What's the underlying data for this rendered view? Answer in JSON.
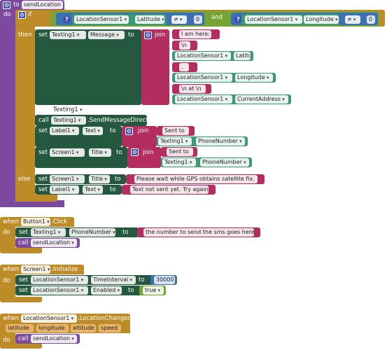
{
  "kw": {
    "to": "to",
    "do": "do",
    "if": "if",
    "then": "then",
    "else": "else",
    "set": "set",
    "call": "call",
    "join": "join",
    "when": "when",
    "and": "and",
    "eq": "≠",
    "num_zero": "0"
  },
  "proc": {
    "name": "sendLocation"
  },
  "cond": {
    "left_comp": "LocationSensor1",
    "left_prop": "Latitude",
    "right_comp": "LocationSensor1",
    "right_prop": "Longitude"
  },
  "then_set": {
    "comp": "Texting1",
    "prop": "Message"
  },
  "join_items": [
    {
      "type": "text",
      "value": "I am here:"
    },
    {
      "type": "text",
      "value": "\\n"
    },
    {
      "type": "getter",
      "comp": "LocationSensor1",
      "prop": "Latitude"
    },
    {
      "type": "text",
      "value": ","
    },
    {
      "type": "getter",
      "comp": "LocationSensor1",
      "prop": "Longitude"
    },
    {
      "type": "text",
      "value": "\\n at \\n"
    },
    {
      "type": "getter",
      "comp": "LocationSensor1",
      "prop": "CurrentAddress"
    }
  ],
  "texting_handle": "Texting1",
  "send_call": {
    "comp": "Texting1",
    "method": ".SendMessageDirect"
  },
  "set_label": {
    "comp": "Label1",
    "prop": "Text",
    "text": "Sent to",
    "getter_comp": "Texting1",
    "getter_prop": "PhoneNumber"
  },
  "set_screen": {
    "comp": "Screen1",
    "prop": "Title",
    "text": "Sent to",
    "getter_comp": "Texting1",
    "getter_prop": "PhoneNumber"
  },
  "else_screen": {
    "comp": "Screen1",
    "prop": "Title",
    "text": "Please wait while GPS obtains satellite fix."
  },
  "else_label": {
    "comp": "Label1",
    "prop": "Text",
    "text": "Text not sent yet. Try again."
  },
  "button_event": {
    "comp": "Button1",
    "event": ".Click",
    "set_comp": "Texting1",
    "set_prop": "PhoneNumber",
    "text": "the number to send the sms goes here.",
    "call": "sendLocation"
  },
  "init_event": {
    "comp": "Screen1",
    "event": ".Initialize",
    "set1_comp": "LocationSensor1",
    "set1_prop": "TimeInterval",
    "set1_val": "30000",
    "set2_comp": "LocationSensor1",
    "set2_prop": "Enabled",
    "set2_val": "true"
  },
  "loc_event": {
    "comp": "LocationSensor1",
    "event": ".LocationChanged",
    "params": [
      "latitude",
      "longitude",
      "altitude",
      "speed"
    ],
    "call": "sendLocation"
  },
  "colors": {
    "proc": "#7b4a9e",
    "control": "#bd8b28",
    "comp": "#25593f",
    "text": "#b32d5e",
    "logic": "#74a535",
    "math": "#3d6fb5",
    "getter": "#3d9974"
  }
}
